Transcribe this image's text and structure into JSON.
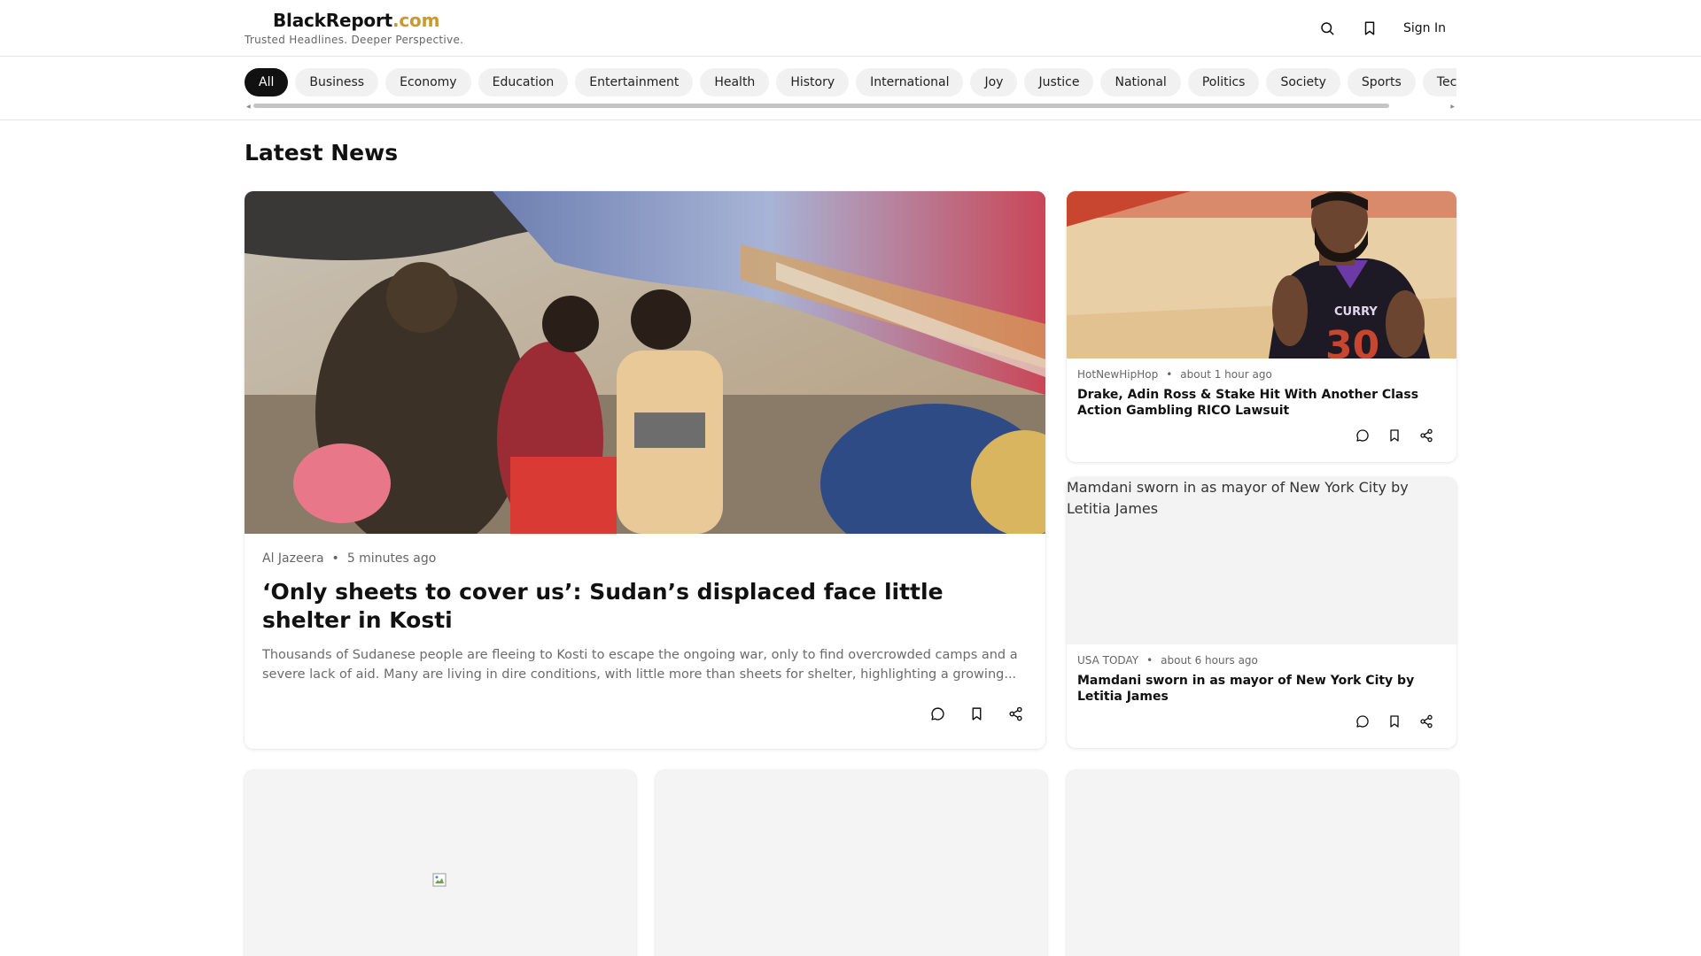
{
  "header": {
    "brand_name": "BlackReport",
    "brand_tld": ".com",
    "tagline": "Trusted Headlines. Deeper Perspective.",
    "search_icon": "search-icon",
    "bookmarks_icon": "bookmark-icon",
    "signin_label": "Sign In"
  },
  "categories": {
    "active": "All",
    "items": [
      "All",
      "Business",
      "Economy",
      "Education",
      "Entertainment",
      "Health",
      "History",
      "International",
      "Joy",
      "Justice",
      "National",
      "Politics",
      "Society",
      "Sports",
      "Tech"
    ]
  },
  "section": {
    "title": "Latest News"
  },
  "featured": {
    "source": "Al Jazeera",
    "time": "5 minutes ago",
    "title": "‘Only sheets to cover us’: Sudan’s displaced face little shelter in Kosti",
    "description": "Thousands of Sudanese people are fleeing to Kosti to escape the ongoing war, only to find overcrowded camps and a severe lack of aid. Many are living in dire conditions, with little more than sheets for shelter, highlighting a growing..."
  },
  "side_articles": [
    {
      "source": "HotNewHipHop",
      "time": "about 1 hour ago",
      "title": "Drake, Adin Ross & Stake Hit With Another Class Action Gambling RICO Lawsuit"
    },
    {
      "source": "USA TODAY",
      "time": "about 6 hours ago",
      "title": "Mamdani sworn in as mayor of New York City by Letitia James",
      "image_alt": "Mamdani sworn in as mayor of New York City by Letitia James"
    }
  ],
  "actions": {
    "comment_icon": "comment-icon",
    "bookmark_icon": "bookmark-icon",
    "share_icon": "share-icon"
  },
  "colors": {
    "brand_accent": "#c99a2e",
    "active_pill": "#111111",
    "pill_bg": "#f1f1f1"
  }
}
